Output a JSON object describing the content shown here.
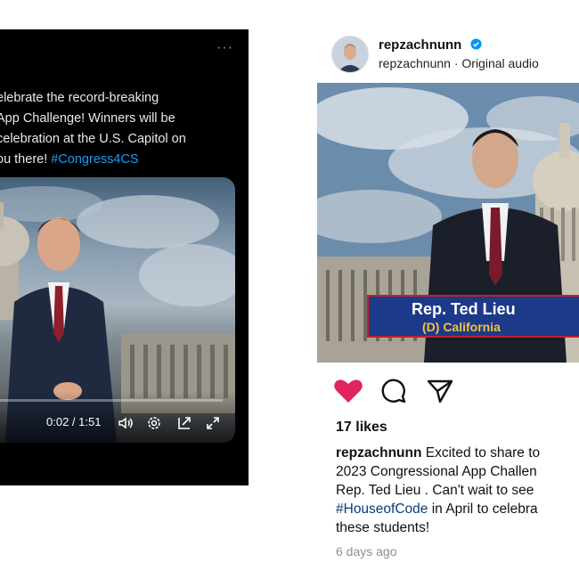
{
  "twitter_post": {
    "more_icon": "more-horizontal-icon",
    "text_lines": [
      "elebrate the record-breaking",
      "App Challenge! Winners will be",
      "celebration at the U.S. Capitol on",
      "ou there! "
    ],
    "hashtag": "#Congress4CS",
    "video": {
      "time": "0:02 / 1:51",
      "progress": 0.018,
      "icons": [
        "volume-icon",
        "settings-icon",
        "picture-in-picture-icon",
        "fullscreen-icon"
      ]
    }
  },
  "instagram_post": {
    "username": "repzachnunn",
    "subtitle": "repzachnunn · Original audio",
    "video": {
      "banner_name": "Rep. Ted Lieu",
      "banner_state": "(D) California"
    },
    "actions": [
      "heart-icon",
      "comment-icon",
      "share-icon"
    ],
    "likes": "17 likes",
    "caption": {
      "username": "repzachnunn",
      "line1_rest": " Excited to share to",
      "line2": "2023 Congressional App Challen",
      "line3": "Rep. Ted Lieu . Can't wait to see",
      "hashtag": "#HouseofCode",
      "line4_rest": " in April to celebra",
      "line5": "these students!"
    },
    "time_ago": "6 days ago",
    "colors": {
      "heart": "#e0245e",
      "verified": "#0095f6",
      "hashtag_twitter": "#1d9bf0"
    }
  }
}
